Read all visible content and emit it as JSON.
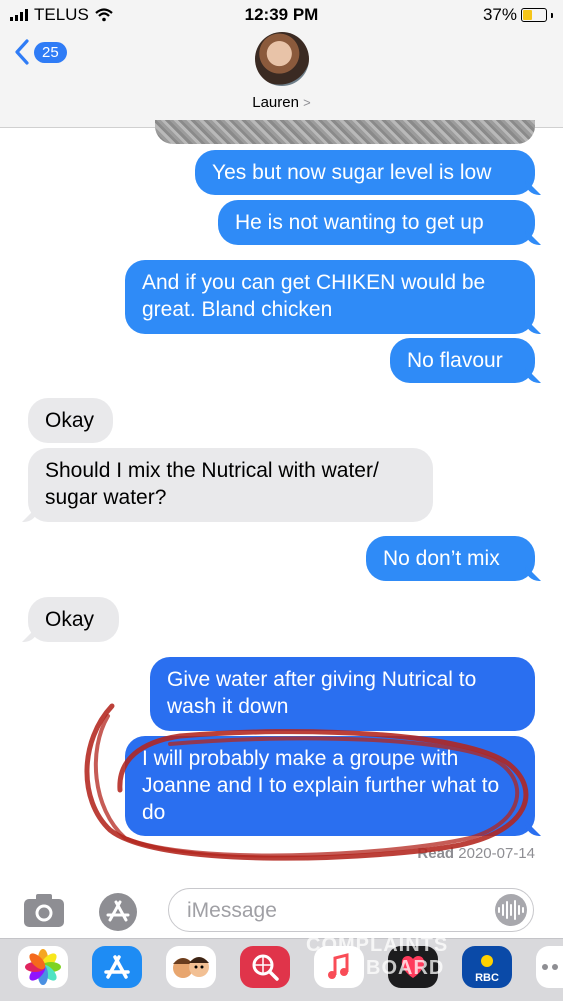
{
  "status_bar": {
    "carrier": "TELUS",
    "time": "12:39 PM",
    "battery_percent": "37%",
    "battery_level": 0.37
  },
  "header": {
    "back_count": "25",
    "contact_name": "Lauren",
    "contact_chevron": ">"
  },
  "messages": [
    {
      "direction": "outgoing",
      "text": "Yes but now sugar level is low"
    },
    {
      "direction": "outgoing",
      "text": "He is not wanting to get up"
    },
    {
      "direction": "outgoing",
      "text": "And if you can get CHIKEN would be great. Bland chicken"
    },
    {
      "direction": "outgoing",
      "text": "No flavour"
    },
    {
      "direction": "incoming",
      "text": "Okay"
    },
    {
      "direction": "incoming",
      "text": "Should I mix the Nutrical with water/ sugar water?"
    },
    {
      "direction": "outgoing",
      "text": "No don’t mix"
    },
    {
      "direction": "incoming",
      "text": "Okay"
    },
    {
      "direction": "outgoing",
      "text": "Give water after giving Nutrical to wash it down"
    },
    {
      "direction": "outgoing",
      "text": "I will probably make a groupe with Joanne and I to explain further what to do"
    }
  ],
  "read_receipt": {
    "label": "Read",
    "date": "2020-07-14"
  },
  "compose": {
    "placeholder": "iMessage"
  },
  "annotation_color": "#b3261e",
  "app_drawer": {
    "apps": [
      {
        "name": "photos-icon",
        "color": "#ffffff"
      },
      {
        "name": "app-store-icon",
        "color": "#1e8cf4"
      },
      {
        "name": "memoji-icon",
        "color": "#ffffff"
      },
      {
        "name": "web-search-icon",
        "color": "#e0344a"
      },
      {
        "name": "music-icon",
        "color": "#ffffff"
      },
      {
        "name": "digital-touch-icon",
        "color": "#1c1c1e"
      },
      {
        "name": "rbc-icon",
        "color": "#0a4aa8"
      },
      {
        "name": "more-icon",
        "color": "#ffffff"
      }
    ],
    "watermark_line1": "COMPLAINTS",
    "watermark_line2": "BOARD",
    "rbc_label": "RBC"
  }
}
